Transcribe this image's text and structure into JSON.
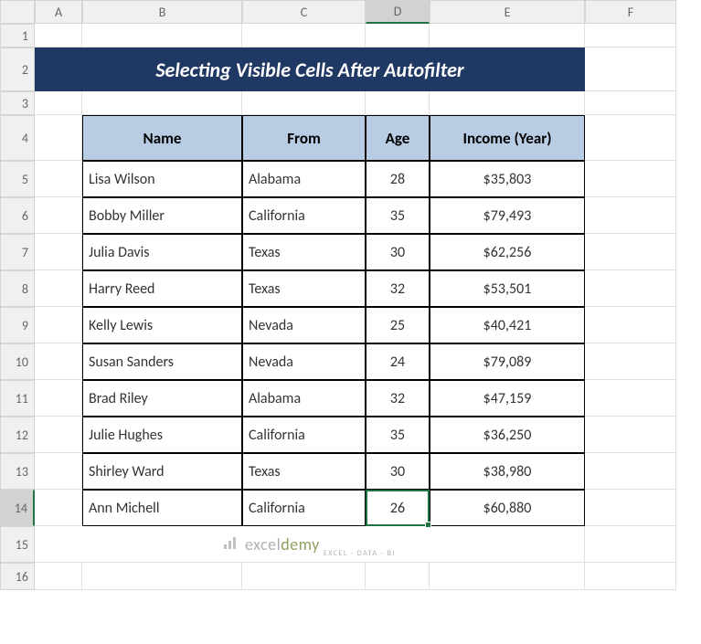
{
  "columns": [
    "A",
    "B",
    "C",
    "D",
    "E",
    "F"
  ],
  "rows": [
    "1",
    "2",
    "3",
    "4",
    "5",
    "6",
    "7",
    "8",
    "9",
    "10",
    "11",
    "12",
    "13",
    "14",
    "15",
    "16"
  ],
  "active_column": "D",
  "active_row": "14",
  "title": "Selecting Visible Cells After Autofilter",
  "headers": {
    "name": "Name",
    "from": "From",
    "age": "Age",
    "income": "Income (Year)"
  },
  "data": [
    {
      "name": "Lisa Wilson",
      "from": "Alabama",
      "age": "28",
      "income": "$35,803"
    },
    {
      "name": "Bobby Miller",
      "from": "California",
      "age": "35",
      "income": "$79,493"
    },
    {
      "name": "Julia Davis",
      "from": "Texas",
      "age": "30",
      "income": "$62,256"
    },
    {
      "name": "Harry Reed",
      "from": "Texas",
      "age": "32",
      "income": "$53,501"
    },
    {
      "name": "Kelly Lewis",
      "from": "Nevada",
      "age": "25",
      "income": "$40,421"
    },
    {
      "name": "Susan Sanders",
      "from": "Nevada",
      "age": "24",
      "income": "$79,089"
    },
    {
      "name": "Brad Riley",
      "from": "Alabama",
      "age": "32",
      "income": "$47,159"
    },
    {
      "name": "Julie Hughes",
      "from": "California",
      "age": "35",
      "income": "$36,250"
    },
    {
      "name": "Shirley Ward",
      "from": "Texas",
      "age": "30",
      "income": "$38,980"
    },
    {
      "name": "Ann Michell",
      "from": "California",
      "age": "26",
      "income": "$60,880"
    }
  ],
  "watermark": {
    "brand_a": "excel",
    "brand_b": "demy",
    "sub": "EXCEL · DATA · BI"
  },
  "chart_data": {
    "type": "table",
    "title": "Selecting Visible Cells After Autofilter",
    "columns": [
      "Name",
      "From",
      "Age",
      "Income (Year)"
    ],
    "rows": [
      [
        "Lisa Wilson",
        "Alabama",
        28,
        35803
      ],
      [
        "Bobby Miller",
        "California",
        35,
        79493
      ],
      [
        "Julia Davis",
        "Texas",
        30,
        62256
      ],
      [
        "Harry Reed",
        "Texas",
        32,
        53501
      ],
      [
        "Kelly Lewis",
        "Nevada",
        25,
        40421
      ],
      [
        "Susan Sanders",
        "Nevada",
        24,
        79089
      ],
      [
        "Brad Riley",
        "Alabama",
        32,
        47159
      ],
      [
        "Julie Hughes",
        "California",
        35,
        36250
      ],
      [
        "Shirley Ward",
        "Texas",
        30,
        38980
      ],
      [
        "Ann Michell",
        "California",
        26,
        60880
      ]
    ]
  }
}
